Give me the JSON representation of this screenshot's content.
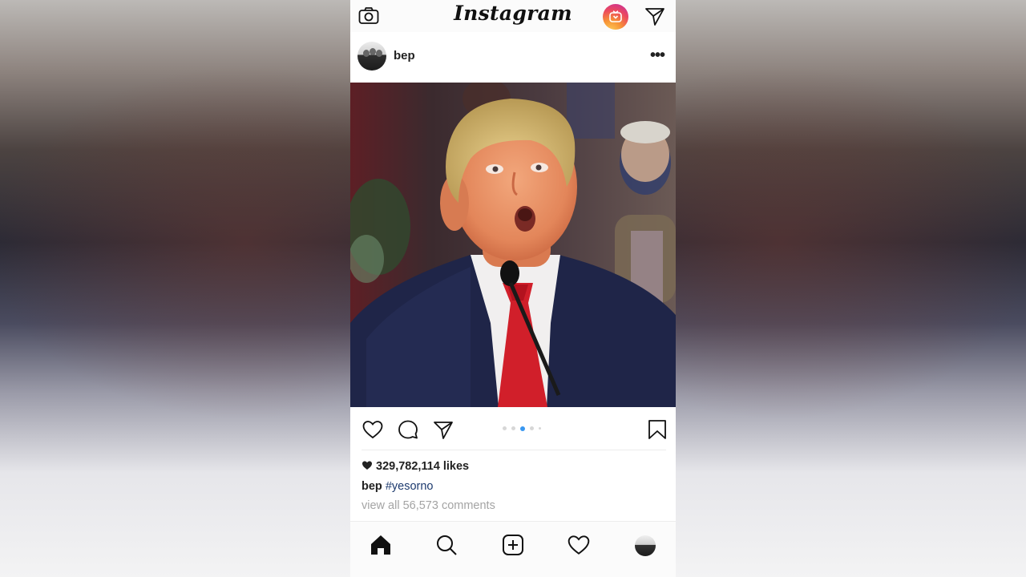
{
  "app": {
    "logo_text": "Instagram"
  },
  "topbar": {
    "camera_icon": "camera-icon",
    "igtv_icon": "igtv-icon",
    "direct_icon": "paper-plane-icon"
  },
  "post": {
    "username": "bep",
    "more_label": "•••",
    "carousel": {
      "count": 5,
      "active_index": 2,
      "accent": "#3897f0"
    },
    "likes": "329,782,114 likes",
    "caption_user": "bep",
    "caption_tag": "#yesorno",
    "view_comments": "view all 56,573 comments"
  },
  "actions": {
    "like_icon": "heart-outline-icon",
    "comment_icon": "comment-icon",
    "share_icon": "paper-plane-icon",
    "save_icon": "bookmark-icon"
  },
  "tabbar": {
    "items": [
      "home-icon",
      "search-icon",
      "add-post-icon",
      "activity-heart-icon",
      "profile-avatar"
    ]
  },
  "colors": {
    "hashtag": "#1d3a6e",
    "muted": "#a4a4a4",
    "text": "#222222"
  }
}
